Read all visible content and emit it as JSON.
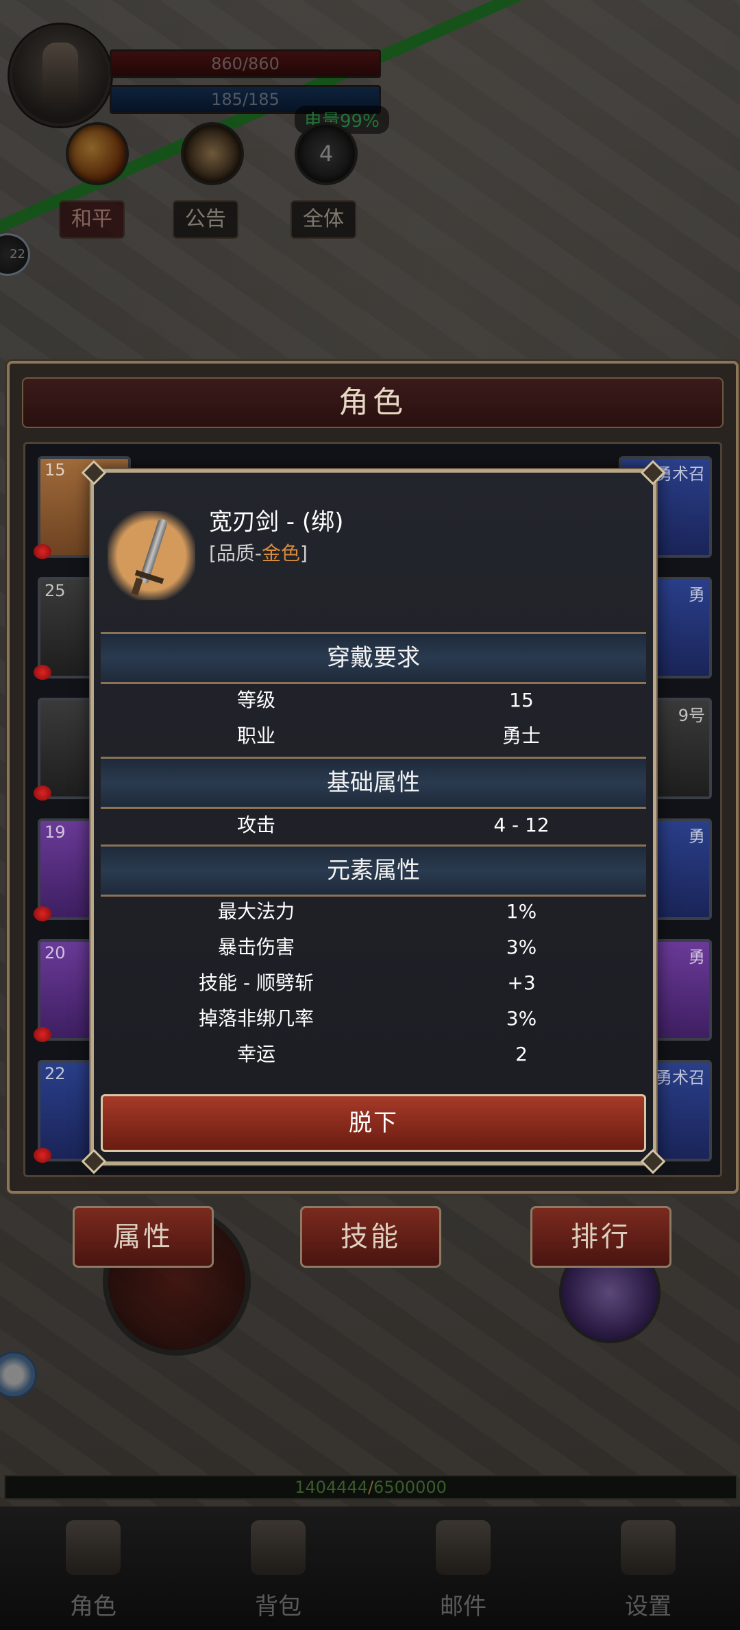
{
  "hud": {
    "hp": "860/860",
    "mp": "185/185",
    "battery": "电量99%",
    "skill_orb_count": "4",
    "mode_chip": "和平",
    "notice_chip": "公告",
    "all_chip": "全体",
    "side_orb_label": "22"
  },
  "panel": {
    "title": "角色",
    "slots": [
      {
        "label": "15",
        "tone": "orange"
      },
      {
        "label": "25",
        "tone": "dark"
      },
      {
        "label": "",
        "tone": "dark"
      },
      {
        "label": "19",
        "tone": "purple"
      },
      {
        "label": "20",
        "tone": "purple"
      },
      {
        "label": "22",
        "tone": "blue"
      }
    ],
    "slots_right": [
      {
        "label": "勇术召",
        "tone": "blue"
      },
      {
        "label": "勇",
        "tone": "blue"
      },
      {
        "label": "9号",
        "tone": "dark"
      },
      {
        "label": "勇",
        "tone": "blue"
      },
      {
        "label": "勇",
        "tone": "purple"
      },
      {
        "label": "勇术召",
        "tone": "blue"
      }
    ]
  },
  "item": {
    "name": "宽刃剑 - (绑)",
    "quality_prefix": "[品质-",
    "quality_value": "金色",
    "quality_suffix": "]",
    "sections": {
      "requirements": "穿戴要求",
      "base": "基础属性",
      "element": "元素属性"
    },
    "requirements": [
      {
        "k": "等级",
        "v": "15"
      },
      {
        "k": "职业",
        "v": "勇士"
      }
    ],
    "base": [
      {
        "k": "攻击",
        "v": "4 - 12"
      }
    ],
    "element": [
      {
        "k": "最大法力",
        "v": "1%"
      },
      {
        "k": "暴击伤害",
        "v": "3%"
      },
      {
        "k": "技能 - 顺劈斩",
        "v": "+3"
      },
      {
        "k": "掉落非绑几率",
        "v": "3%"
      },
      {
        "k": "幸运",
        "v": "2"
      }
    ],
    "unequip": "脱下"
  },
  "buttons": {
    "attr": "属性",
    "skill": "技能",
    "rank": "排行"
  },
  "xp": {
    "current": "1404444",
    "sep": "/",
    "max": "6500000"
  },
  "nav": [
    {
      "label": "角色"
    },
    {
      "label": "背包"
    },
    {
      "label": "邮件"
    },
    {
      "label": "设置"
    }
  ]
}
